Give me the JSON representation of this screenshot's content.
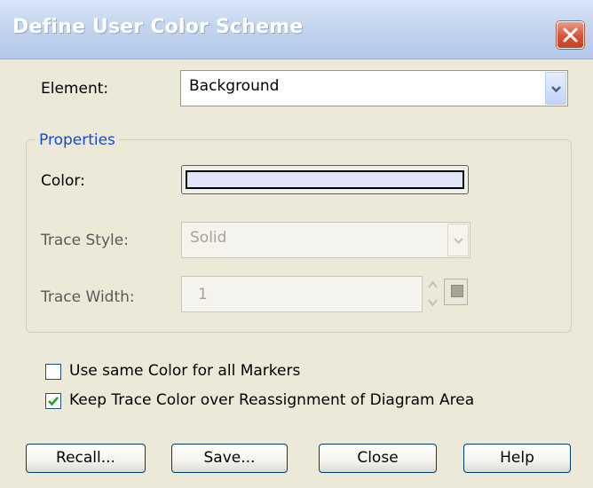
{
  "window": {
    "title": "Define User Color Scheme"
  },
  "element": {
    "label": "Element:",
    "value": "Background"
  },
  "properties": {
    "title": "Properties",
    "color_label": "Color:",
    "color_value": "#e2e5f7",
    "trace_style_label": "Trace Style:",
    "trace_style_value": "Solid",
    "trace_width_label": "Trace Width:",
    "trace_width_value": "1"
  },
  "options": {
    "same_color": {
      "label": "Use same Color for all Markers",
      "checked": false
    },
    "keep_trace": {
      "label": "Keep Trace Color over Reassignment of Diagram Area",
      "checked": true
    }
  },
  "buttons": {
    "recall": "Recall...",
    "save": "Save...",
    "close": "Close",
    "help": "Help"
  },
  "icons": {
    "close": "close-icon",
    "dropdown": "chevron-down-icon",
    "spin_up": "spin-up-icon",
    "spin_down": "spin-down-icon",
    "check": "checkmark-icon"
  },
  "colors": {
    "title_bar": "#c3d5ee",
    "close_button": "#d8533a",
    "group_title": "#1b48cf",
    "check": "#21a121"
  }
}
